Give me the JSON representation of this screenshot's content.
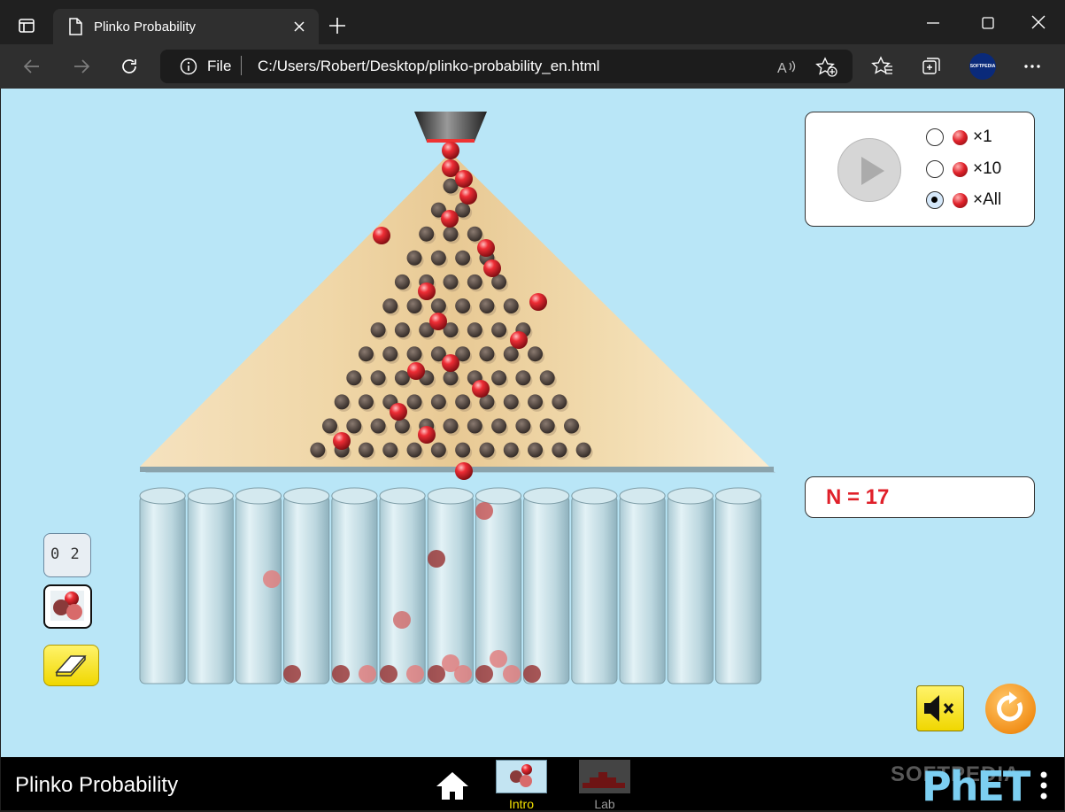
{
  "browser": {
    "tab_title": "Plinko Probability",
    "address_scheme": "File",
    "address_url": "C:/Users/Robert/Desktop/plinko-probability_en.html",
    "profile_badge": "SOFTPEDIA"
  },
  "controls": {
    "options": [
      {
        "label": "×1",
        "selected": false
      },
      {
        "label": "×10",
        "selected": false
      },
      {
        "label": "×All",
        "selected": true
      }
    ]
  },
  "counter": {
    "text": "N = 17"
  },
  "board": {
    "rows": 12,
    "bins": 13,
    "ball_color": "#e0222b",
    "board_color": "#f0d9ad",
    "background_color": "#b9e6f7"
  },
  "navbar": {
    "title": "Plinko Probability",
    "tabs": [
      {
        "label": "Intro",
        "active": true
      },
      {
        "label": "Lab",
        "active": false
      }
    ],
    "logo": "PhET",
    "watermark": "SOFTPEDIA"
  },
  "colors": {
    "accent_yellow": "#f3e000",
    "counter_red": "#e0202a",
    "reset_orange": "#f2901a"
  }
}
